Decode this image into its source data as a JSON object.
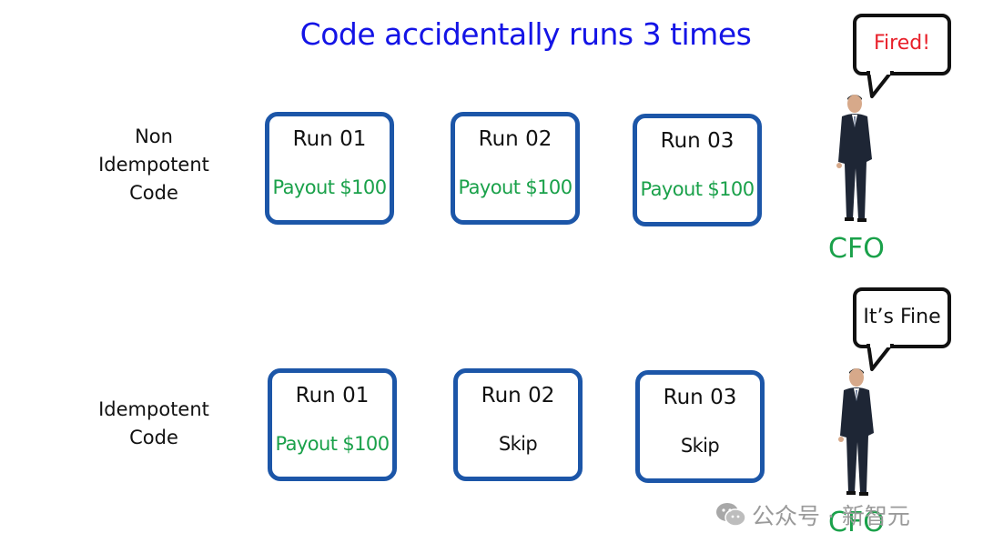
{
  "title": "Code accidentally runs 3 times",
  "rows": [
    {
      "label": "Non\nIdempotent\nCode",
      "runs": [
        {
          "run": "Run 01",
          "result": "Payout $100",
          "type": "payout"
        },
        {
          "run": "Run 02",
          "result": "Payout $100",
          "type": "payout"
        },
        {
          "run": "Run 03",
          "result": "Payout $100",
          "type": "payout"
        }
      ],
      "speech": "Fired!",
      "speech_color": "#e8202a",
      "person_label": "CFO"
    },
    {
      "label": "Idempotent\nCode",
      "runs": [
        {
          "run": "Run 01",
          "result": "Payout $100",
          "type": "payout"
        },
        {
          "run": "Run 02",
          "result": "Skip",
          "type": "skip"
        },
        {
          "run": "Run 03",
          "result": "Skip",
          "type": "skip"
        }
      ],
      "speech": "It’s Fine",
      "speech_color": "#111111",
      "person_label": "CFO"
    }
  ],
  "watermark": {
    "icon": "wechat-icon",
    "text": "公众号 · 新智元"
  },
  "colors": {
    "title": "#1414e6",
    "box_border": "#1c56a8",
    "payout": "#1aa14a",
    "cfo": "#1aa14a"
  }
}
